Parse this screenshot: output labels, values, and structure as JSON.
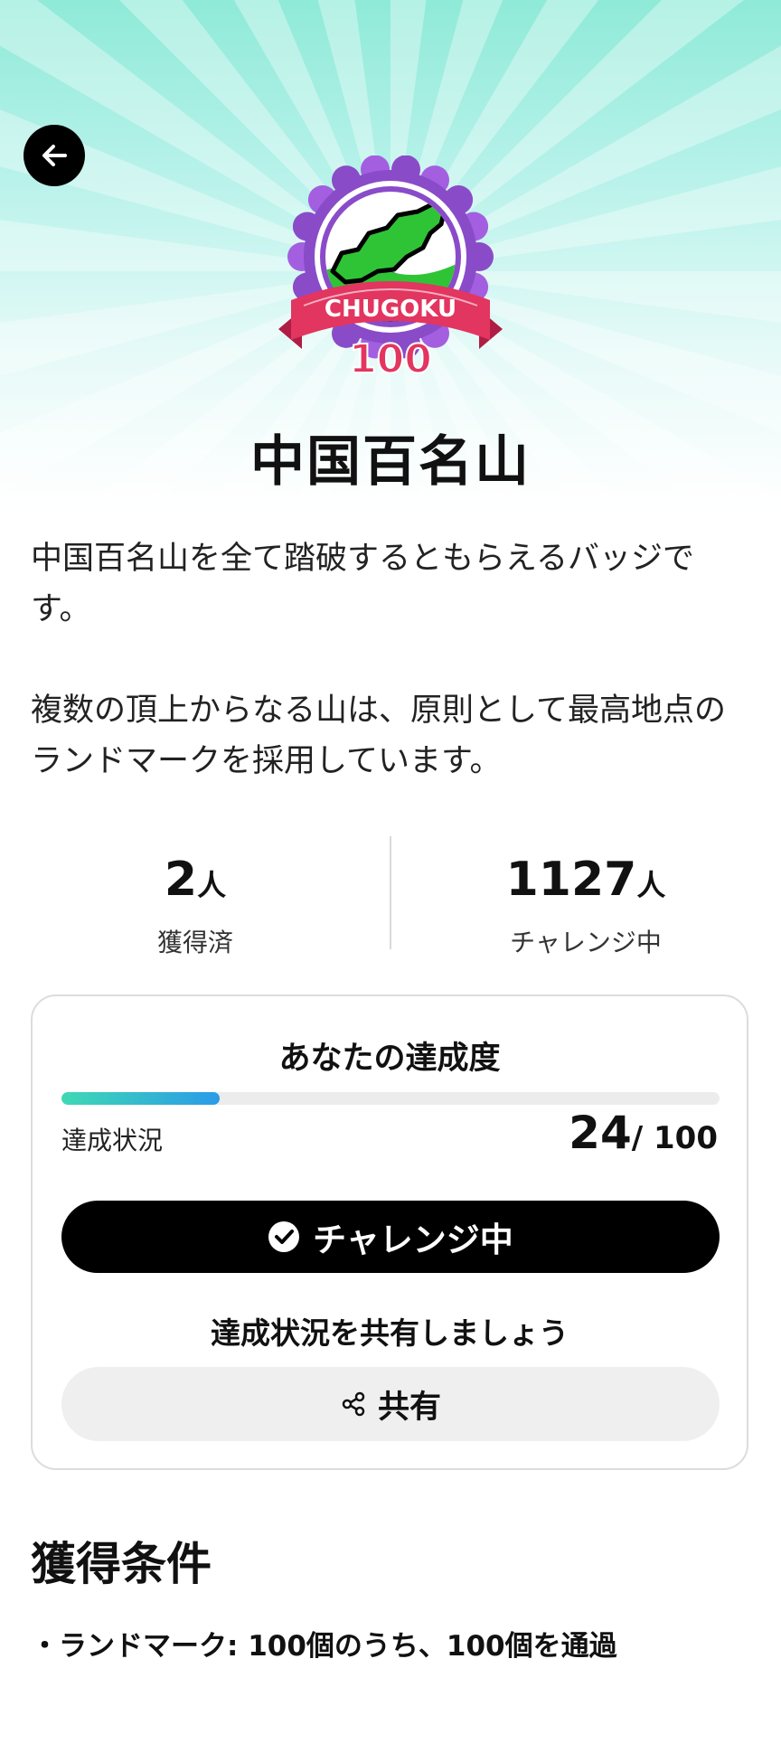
{
  "header": {
    "back_icon": "arrow-left-icon"
  },
  "badge": {
    "emblem_text": "CHUGOKU",
    "emblem_number": "100",
    "title": "中国百名山",
    "colors": {
      "rim": "#8a4bc9",
      "ribbon": "#e2355f",
      "mountain": "#2fc436"
    }
  },
  "description": {
    "paragraph_1": "中国百名山を全て踏破するともらえるバッジです。",
    "paragraph_2": "複数の頂上からなる山は、原則として最高地点のランドマークを採用しています。"
  },
  "stats": {
    "earned_value": "2",
    "earned_unit": "人",
    "earned_label": "獲得済",
    "challenging_value": "1127",
    "challenging_unit": "人",
    "challenging_label": "チャレンジ中"
  },
  "progress": {
    "heading": "あなたの達成度",
    "status_label": "達成状況",
    "done": "24",
    "total": "/ 100",
    "fraction": 0.24,
    "challenge_button_label": "チャレンジ中",
    "challenge_icon": "check-circle-icon",
    "share_prompt": "達成状況を共有しましょう",
    "share_button_label": "共有",
    "share_icon": "share-icon"
  },
  "conditions": {
    "title": "獲得条件",
    "items": [
      "・ランドマーク: 100個のうち、100個を通過"
    ]
  }
}
